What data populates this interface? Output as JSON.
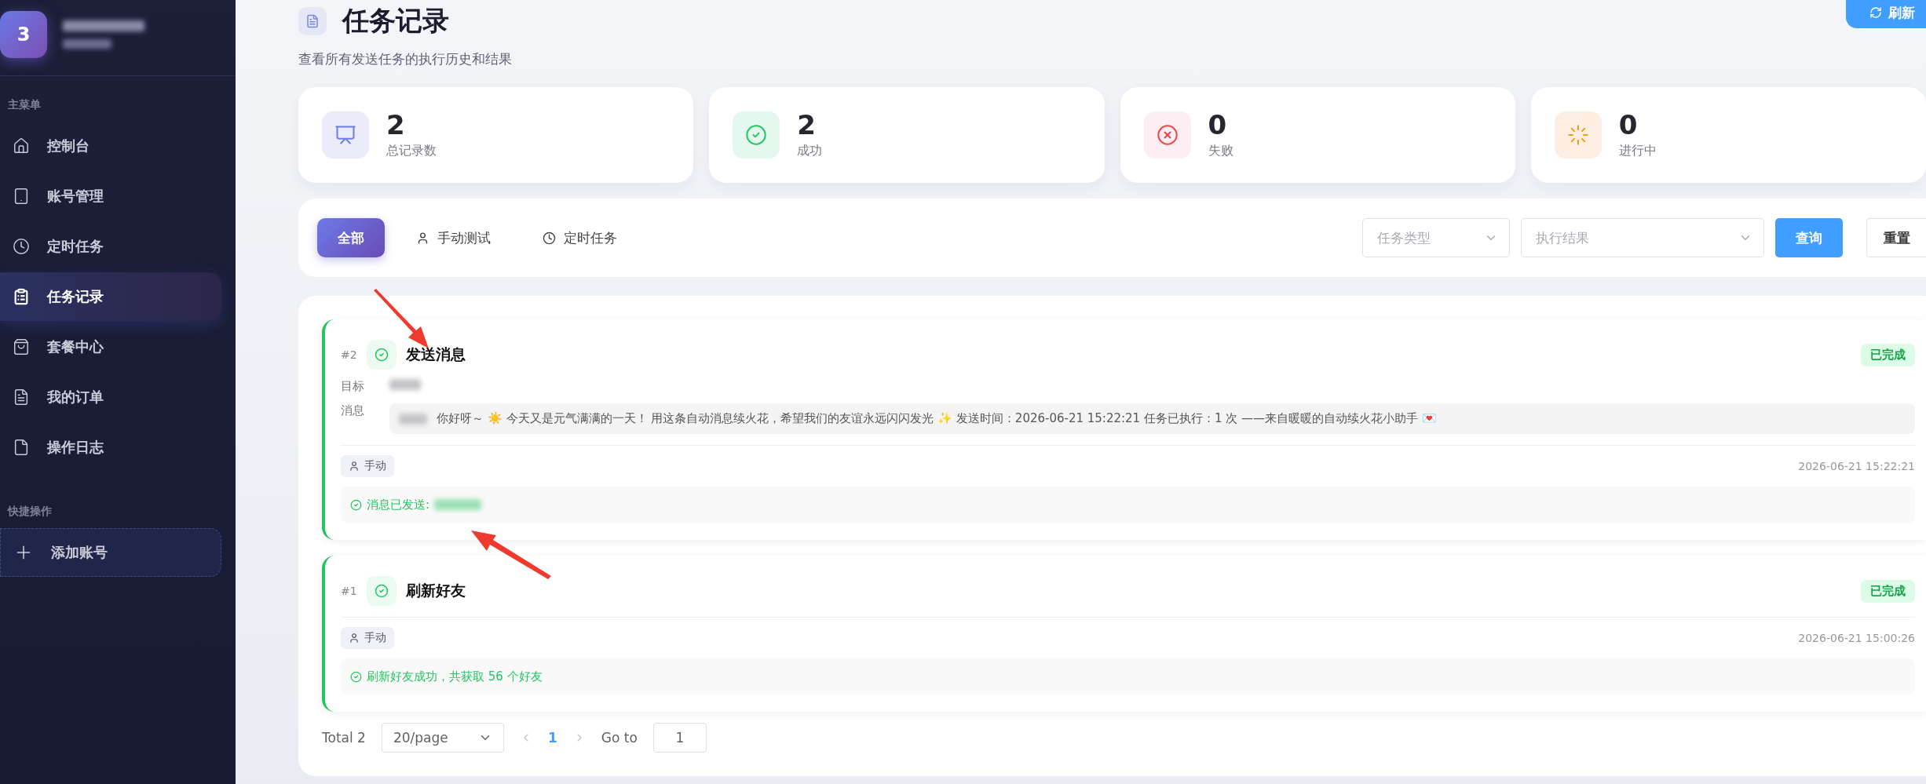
{
  "sidebar": {
    "avatar": "3",
    "name_redacted": true,
    "sections": [
      {
        "title": "主菜单",
        "items": [
          {
            "label": "控制台",
            "selected": false
          },
          {
            "label": "账号管理",
            "selected": false
          },
          {
            "label": "定时任务",
            "selected": false
          },
          {
            "label": "任务记录",
            "selected": true
          },
          {
            "label": "套餐中心",
            "selected": false
          },
          {
            "label": "我的订单",
            "selected": false
          },
          {
            "label": "操作日志",
            "selected": false
          }
        ]
      }
    ],
    "quick_actions": {
      "title": "快捷操作",
      "items": [
        {
          "label": "添加账号"
        }
      ]
    }
  },
  "header": {
    "title": "任务记录",
    "subtitle": "查看所有发送任务的执行历史和结果",
    "refresh_button": "刷新"
  },
  "stats": [
    {
      "kind": "total",
      "value": "2",
      "label": "总记录数"
    },
    {
      "kind": "success",
      "value": "2",
      "label": "成功"
    },
    {
      "kind": "failed",
      "value": "0",
      "label": "失败"
    },
    {
      "kind": "running",
      "value": "0",
      "label": "进行中"
    }
  ],
  "filters": {
    "tabs": [
      {
        "label": "全部",
        "selected": true
      },
      {
        "label": "手动测试",
        "selected": false
      },
      {
        "label": "定时任务",
        "selected": false
      }
    ],
    "selects": [
      {
        "placeholder": "任务类型"
      },
      {
        "placeholder": "执行结果"
      }
    ],
    "query_button": "查询",
    "reset_button": "重置"
  },
  "records": [
    {
      "number": "#2",
      "kind": "success",
      "title": "发送消息",
      "status": "已完成",
      "fields": [
        {
          "label": "目标",
          "value_redacted": true
        },
        {
          "label": "消息",
          "value_redacted": true,
          "value": "你好呀～ ☀️ 今天又是元气满满的一天！ 用这条自动消息续火花，希望我们的友谊永远闪闪发光 ✨ 发送时间：2026-06-21 15:22:21 任务已执行：1 次 ——来自暖暖的自动续火花小助手 💌"
        }
      ],
      "trigger": "手动",
      "time": "2026-06-21 15:22:21",
      "result": "消息已发送:",
      "result_redacted": true
    },
    {
      "number": "#1",
      "kind": "success",
      "title": "刷新好友",
      "status": "已完成",
      "trigger": "手动",
      "time": "2026-06-21 15:00:26",
      "result": "刷新好友成功，共获取 56 个好友",
      "result_redacted": false
    }
  ],
  "pagination": {
    "total": "Total 2",
    "page_size": "20/page",
    "pages": [
      {
        "label": "1",
        "selected": true
      }
    ],
    "goto_label": "Go to",
    "goto_value": "1"
  }
}
